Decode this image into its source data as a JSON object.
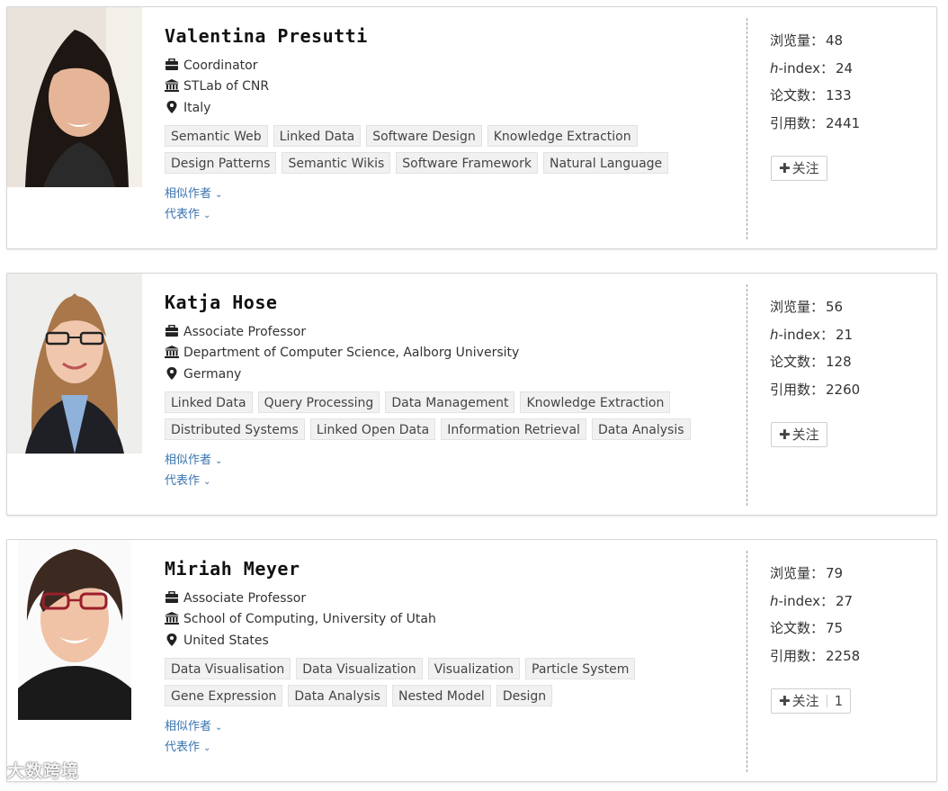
{
  "authors": [
    {
      "name": "Valentina Presutti",
      "position": "Coordinator",
      "affiliation": "STLab of CNR",
      "location": "Italy",
      "tags_row1": [
        "Semantic Web",
        "Linked Data",
        "Software Design",
        "Knowledge Extraction"
      ],
      "tags_row2": [
        "Design Patterns",
        "Semantic Wikis",
        "Software Framework",
        "Natural Language"
      ],
      "similar_authors_label": "相似作者",
      "representative_works_label": "代表作",
      "views_label": "浏览量：",
      "views": "48",
      "hindex_label_h": "h",
      "hindex_label_rest": "-index：",
      "hindex": "24",
      "papers_label": "论文数：",
      "papers": "133",
      "citations_label": "引用数：",
      "citations": "2441",
      "follow_label": "关注",
      "follow_count": ""
    },
    {
      "name": "Katja Hose",
      "position": "Associate Professor",
      "affiliation": "Department of Computer Science, Aalborg University",
      "location": "Germany",
      "tags_row1": [
        "Linked Data",
        "Query Processing",
        "Data Management",
        "Knowledge Extraction"
      ],
      "tags_row2": [
        "Distributed Systems",
        "Linked Open Data",
        "Information Retrieval",
        "Data Analysis"
      ],
      "similar_authors_label": "相似作者",
      "representative_works_label": "代表作",
      "views_label": "浏览量：",
      "views": "56",
      "hindex_label_h": "h",
      "hindex_label_rest": "-index：",
      "hindex": "21",
      "papers_label": "论文数：",
      "papers": "128",
      "citations_label": "引用数：",
      "citations": "2260",
      "follow_label": "关注",
      "follow_count": ""
    },
    {
      "name": "Miriah Meyer",
      "position": "Associate Professor",
      "affiliation": "School of Computing, University of Utah",
      "location": "United States",
      "tags_row1": [
        "Data Visualisation",
        "Data Visualization",
        "Visualization",
        "Particle System"
      ],
      "tags_row2": [
        "Gene Expression",
        "Data Analysis",
        "Nested Model",
        "Design"
      ],
      "similar_authors_label": "相似作者",
      "representative_works_label": "代表作",
      "views_label": "浏览量：",
      "views": "79",
      "hindex_label_h": "h",
      "hindex_label_rest": "-index：",
      "hindex": "27",
      "papers_label": "论文数：",
      "papers": "75",
      "citations_label": "引用数：",
      "citations": "2258",
      "follow_label": "关注",
      "follow_count": "1"
    }
  ],
  "watermark": "大数跨境",
  "colors": {
    "link": "#3a74b0",
    "tag_bg": "#f1f1f1",
    "border": "#d6d6d6"
  },
  "icons": {
    "position": "briefcase-icon",
    "affiliation": "institution-icon",
    "location": "map-pin-icon",
    "follow": "plus-icon",
    "expand": "chevron-down-icon"
  }
}
